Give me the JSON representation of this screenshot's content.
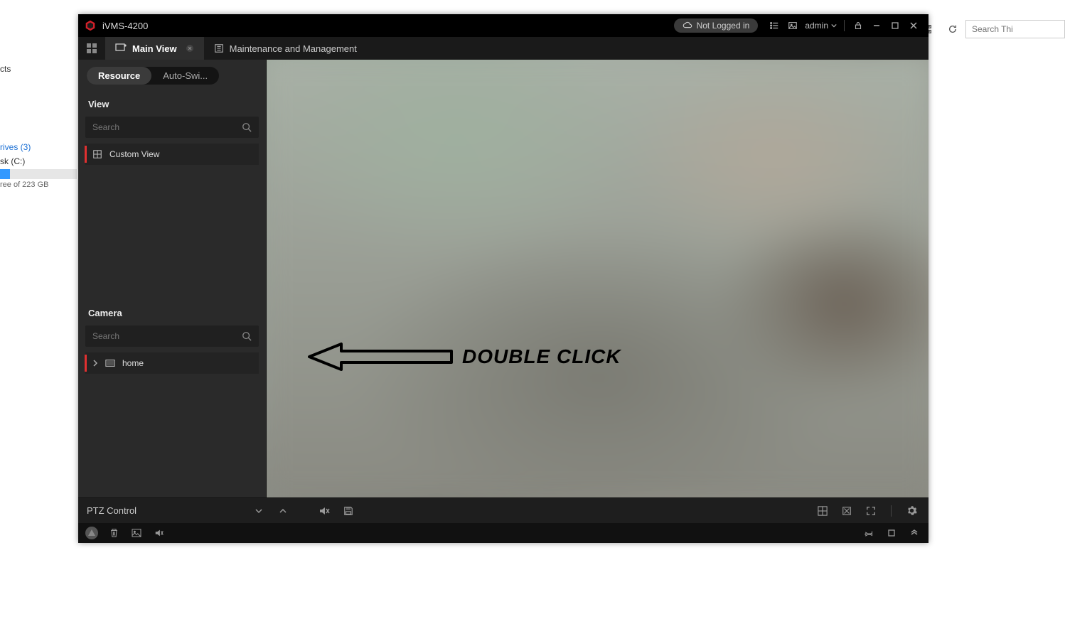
{
  "desktop": {
    "side_text_cts": "cts",
    "drives_header": "rives (3)",
    "drive_name": "sk (C:)",
    "drive_free": "ree of 223 GB",
    "search_placeholder": "Search Thi"
  },
  "app": {
    "title": "iVMS-4200",
    "login_status": "Not Logged in",
    "user": "admin"
  },
  "tabs": [
    {
      "label": "Main View",
      "active": true,
      "closable": true
    },
    {
      "label": "Maintenance and Management",
      "active": false,
      "closable": false
    }
  ],
  "sidebar": {
    "segments": {
      "resource": "Resource",
      "autoswitch": "Auto-Swi..."
    },
    "view_header": "View",
    "view_search_placeholder": "Search",
    "view_items": [
      {
        "label": "Custom View"
      }
    ],
    "camera_header": "Camera",
    "camera_search_placeholder": "Search",
    "camera_items": [
      {
        "label": "home"
      }
    ]
  },
  "annotation_text": "DOUBLE CLICK",
  "bottom": {
    "ptz_label": "PTZ Control"
  }
}
